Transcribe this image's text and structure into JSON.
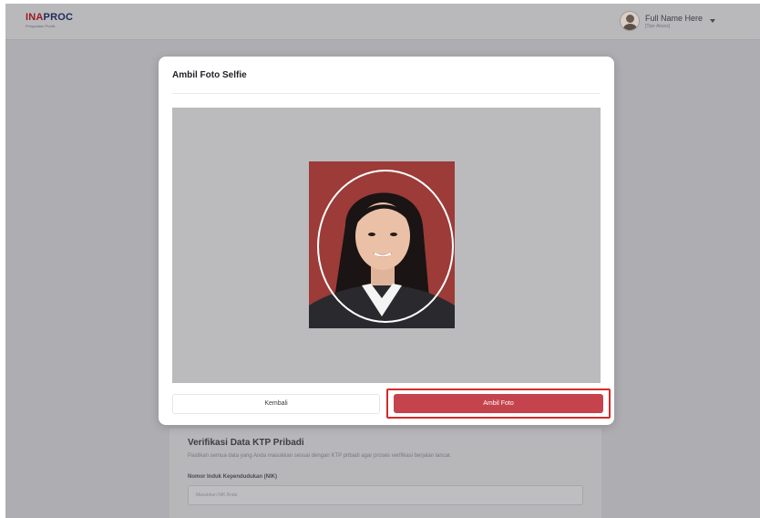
{
  "header": {
    "logo_ina": "INA",
    "logo_proc": "PROC",
    "logo_sub": "Pengadaan Publik",
    "user_name": "Full Name Here",
    "user_role": "[Tipe Akses]",
    "avatar_icon": "avatar-icon",
    "dropdown_icon": "chevron-down-icon"
  },
  "background_form": {
    "title": "Verifikasi Data KTP Pribadi",
    "description": "Pastikan semua data yang Anda masukkan sesuai dengan KTP pribadi agar proses verifikasi berjalan lancar.",
    "nik_label": "Nomor Induk Kependudukan (NIK)",
    "nik_placeholder": "Masukkan NIK Anda"
  },
  "modal": {
    "title": "Ambil Foto Selfie",
    "back_label": "Kembali",
    "take_photo_label": "Ambil Foto"
  },
  "colors": {
    "primary": "#c4434d",
    "highlight": "#d62a2a",
    "photo_bg": "#9c3b38"
  }
}
